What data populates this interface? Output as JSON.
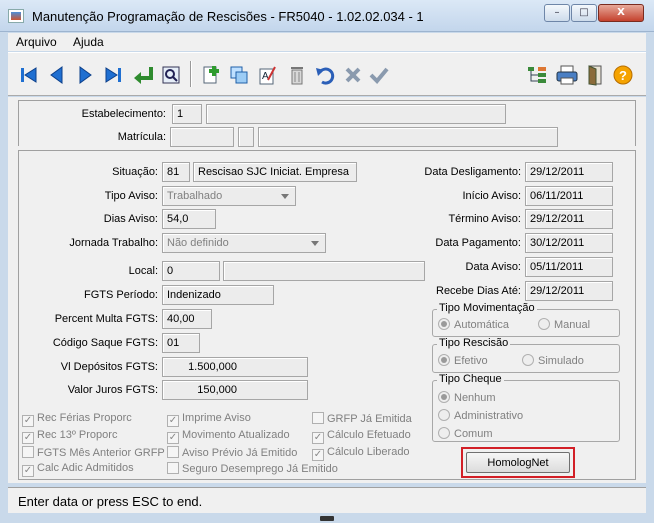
{
  "window": {
    "title": "Manutenção Programação de Rescisões - FR5040 - 1.02.02.034 - 1",
    "minimize": "–",
    "maximize": "□",
    "close": "X"
  },
  "menu": {
    "file": "Arquivo",
    "help": "Ajuda"
  },
  "toolbar": {
    "icons": [
      "first-icon",
      "previous-icon",
      "next-icon",
      "last-icon",
      "goto-icon",
      "search-icon",
      "add-icon",
      "copy-icon",
      "edit-icon",
      "delete-icon",
      "undo-icon",
      "cancel-icon",
      "confirm-icon",
      "tree-icon",
      "print-icon",
      "exit-icon",
      "help-icon"
    ]
  },
  "header": {
    "estabelecimento_label": "Estabelecimento:",
    "estabelecimento_value": "1",
    "matricula_label": "Matrícula:"
  },
  "form": {
    "situacao_label": "Situação:",
    "situacao_code": "81",
    "situacao_desc": "Rescisao SJC Iniciat. Empresa",
    "tipo_aviso_label": "Tipo Aviso:",
    "tipo_aviso_value": "Trabalhado",
    "dias_aviso_label": "Dias Aviso:",
    "dias_aviso_value": "54,0",
    "jornada_label": "Jornada Trabalho:",
    "jornada_value": "Não definido",
    "local_label": "Local:",
    "local_value": "0",
    "fgts_periodo_label": "FGTS Período:",
    "fgts_periodo_value": "Indenizado",
    "percent_multa_label": "Percent Multa FGTS:",
    "percent_multa_value": "40,00",
    "codigo_saque_label": "Código Saque FGTS:",
    "codigo_saque_value": "01",
    "vl_depositos_label": "Vl Depósitos FGTS:",
    "vl_depositos_value": "1.500,000",
    "valor_juros_label": "Valor Juros FGTS:",
    "valor_juros_value": "150,000"
  },
  "dates": {
    "desligamento_label": "Data Desligamento:",
    "desligamento_value": "29/12/2011",
    "inicio_aviso_label": "Início Aviso:",
    "inicio_aviso_value": "06/11/2011",
    "termino_aviso_label": "Término Aviso:",
    "termino_aviso_value": "29/12/2011",
    "pagamento_label": "Data Pagamento:",
    "pagamento_value": "30/12/2011",
    "data_aviso_label": "Data Aviso:",
    "data_aviso_value": "05/11/2011",
    "recebe_dias_label": "Recebe Dias Até:",
    "recebe_dias_value": "29/12/2011"
  },
  "tipo_movimentacao": {
    "caption": "Tipo Movimentação",
    "automatica": "Automática",
    "manual": "Manual"
  },
  "tipo_rescisao": {
    "caption": "Tipo Rescisão",
    "efetivo": "Efetivo",
    "simulado": "Simulado"
  },
  "tipo_cheque": {
    "caption": "Tipo Cheque",
    "nenhum": "Nenhum",
    "administrativo": "Administrativo",
    "comum": "Comum"
  },
  "checks": {
    "rec_ferias": "Rec Férias Proporc",
    "rec_13": "Rec 13º Proporc",
    "fgts_mes": "FGTS Mês Anterior GRFP",
    "calc_adic": "Calc Adic Admitidos",
    "imprime_aviso": "Imprime Aviso",
    "movimento": "Movimento Atualizado",
    "aviso_previo": "Aviso Prévio Já Emitido",
    "seguro": "Seguro Desemprego Já Emitido",
    "grfp": "GRFP Já Emitida",
    "calculo_efetuado": "Cálculo Efetuado",
    "calculo_liberado": "Cálculo Liberado"
  },
  "homolog_button": "HomologNet",
  "status": "Enter data or press ESC to end."
}
